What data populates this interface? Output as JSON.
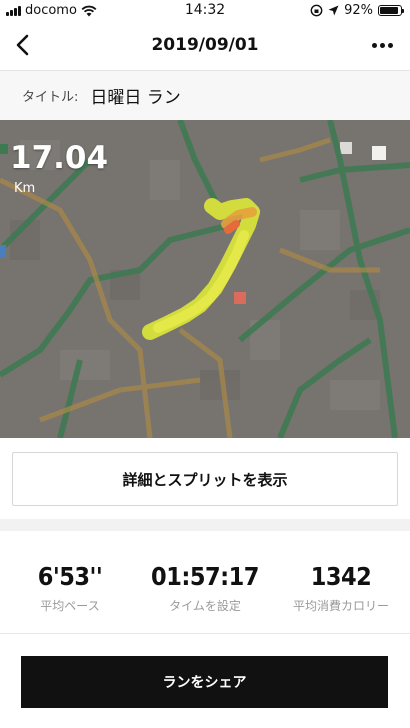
{
  "status_bar": {
    "carrier": "docomo",
    "time": "14:32",
    "battery": "92%",
    "battery_level": 0.92
  },
  "nav": {
    "title": "2019/09/01"
  },
  "activity": {
    "title_label": "タイトル:",
    "title_value": "日曜日 ラン"
  },
  "map": {
    "distance": "17.04",
    "distance_unit": "Km"
  },
  "buttons": {
    "details": "詳細とスプリットを表示",
    "share": "ランをシェア"
  },
  "stats": [
    {
      "value": "6'53''",
      "label": "平均ペース"
    },
    {
      "value": "01:57:17",
      "label": "タイムを設定"
    },
    {
      "value": "1342",
      "label": "平均消費カロリー"
    }
  ],
  "colors": {
    "route": "#d8e23a",
    "route_hot": "#e56a3c",
    "map_base": "#77746f",
    "road_green": "#3d7a52",
    "road_orange": "#a8874a"
  },
  "icons": {
    "wifi": "wifi-icon",
    "location": "location-arrow-icon",
    "back": "chevron-left-icon",
    "more": "more-dots-icon"
  }
}
